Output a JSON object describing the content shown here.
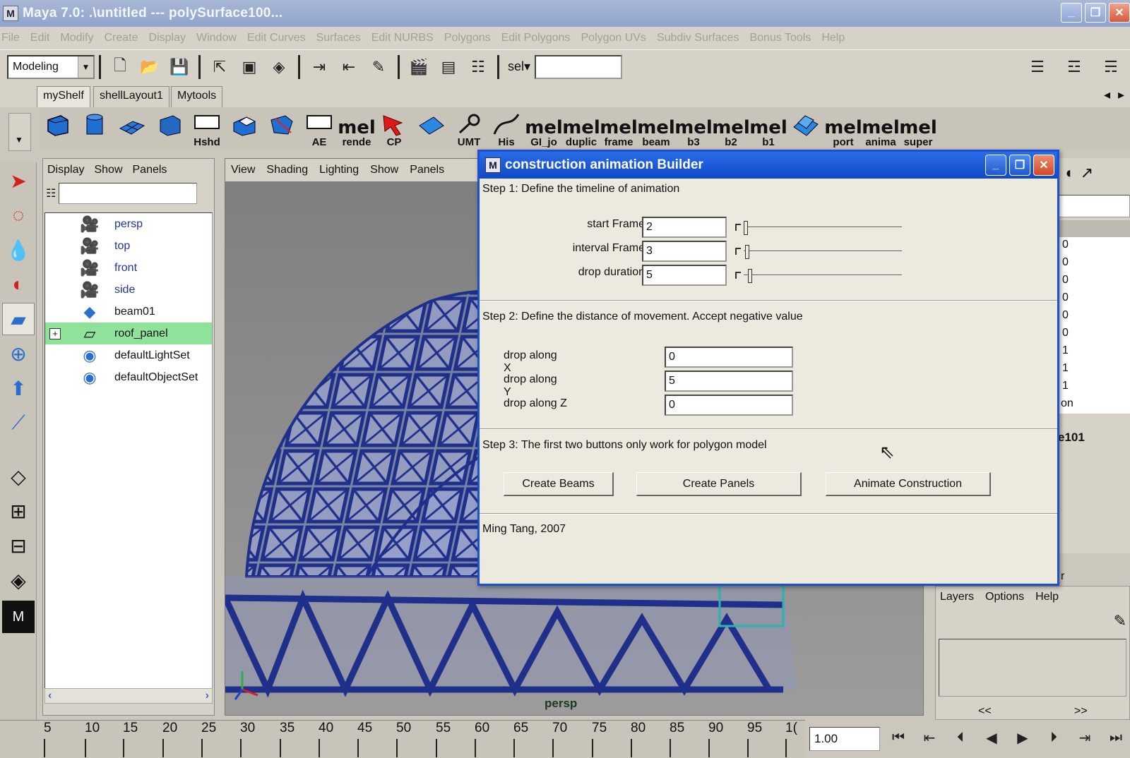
{
  "window": {
    "title": "Maya 7.0: .\\untitled   ---   polySurface100...",
    "btn_min": "_",
    "btn_max": "❐",
    "btn_close": "✕"
  },
  "menu": [
    "File",
    "Edit",
    "Modify",
    "Create",
    "Display",
    "Window",
    "Edit Curves",
    "Surfaces",
    "Edit NURBS",
    "Polygons",
    "Edit Polygons",
    "Polygon UVs",
    "Subdiv Surfaces",
    "Bonus Tools",
    "Help"
  ],
  "toolbar": {
    "mode": "Modeling",
    "sel_label": "sel▾",
    "sel_value": ""
  },
  "shelf_tabs": [
    "myShelf",
    "shellLayout1",
    "Mytools"
  ],
  "shelf": {
    "icon_items": [
      "cube",
      "cylinder",
      "plane",
      "cube2"
    ],
    "labels": [
      "Hshd",
      "",
      "",
      "AE",
      "rende",
      "CP",
      "",
      "UMT",
      "His",
      "GI_jo",
      "duplic",
      "frame",
      "beam",
      "b3",
      "b2",
      "b1",
      "",
      "port",
      "anima",
      "super"
    ],
    "mel": "mel"
  },
  "outliner": {
    "menu": [
      "Display",
      "Show",
      "Panels"
    ],
    "items": [
      {
        "label": "persp",
        "type": "camera"
      },
      {
        "label": "top",
        "type": "camera"
      },
      {
        "label": "front",
        "type": "camera"
      },
      {
        "label": "side",
        "type": "camera"
      },
      {
        "label": "beam01",
        "type": "mesh"
      },
      {
        "label": "roof_panel",
        "type": "mesh"
      },
      {
        "label": "defaultLightSet",
        "type": "set"
      },
      {
        "label": "defaultObjectSet",
        "type": "set"
      }
    ],
    "expander": "+"
  },
  "viewport": {
    "menu": [
      "View",
      "Shading",
      "Lighting",
      "Show",
      "Panels"
    ],
    "camera": "persp",
    "mesh_color": "#1f2f8a"
  },
  "right_panel": {
    "values": [
      "0",
      "0",
      "0",
      "0",
      "0",
      "0",
      "1",
      "1",
      "1",
      "on"
    ],
    "node_name": "e101",
    "partial_label": "r"
  },
  "layers": {
    "menu": [
      "Layers",
      "Options",
      "Help"
    ],
    "nav": [
      "<<",
      ">>"
    ]
  },
  "timeline": {
    "ticks": [
      "5",
      "10",
      "15",
      "20",
      "25",
      "30",
      "35",
      "40",
      "45",
      "50",
      "55",
      "60",
      "65",
      "70",
      "75",
      "80",
      "85",
      "90",
      "95",
      "1("
    ],
    "current_time": "1.00"
  },
  "dialog": {
    "title": "construction animation Builder",
    "step1": "Step 1: Define the timeline of animation",
    "start_frame_label": "start Frame",
    "start_frame_value": "2",
    "interval_frame_label": "interval Frame",
    "interval_frame_value": "3",
    "drop_duration_label": "drop duration",
    "drop_duration_value": "5",
    "step2": "Step 2: Define the distance of movement. Accept negative value",
    "drop_x_label": "drop along X",
    "drop_x_value": "0",
    "drop_y_label": "drop along Y",
    "drop_y_value": "5",
    "drop_z_label": "drop along Z",
    "drop_z_value": "0",
    "step3": "Step 3: The first two buttons only work for polygon model",
    "btn_beams": "Create Beams",
    "btn_panels": "Create Panels",
    "btn_animate": "Animate Construction",
    "footer": "Ming Tang, 2007"
  }
}
